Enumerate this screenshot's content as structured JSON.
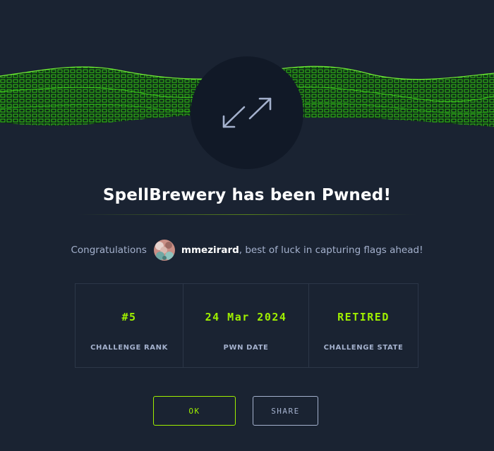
{
  "title": "SpellBrewery has been Pwned!",
  "congrats": {
    "prefix": "Congratulations",
    "username": "mmezirard",
    "suffix": ", best of luck in capturing flags ahead!"
  },
  "stats": [
    {
      "value": "#5",
      "label": "CHALLENGE RANK"
    },
    {
      "value": "24 Mar 2024",
      "label": "PWN DATE"
    },
    {
      "value": "RETIRED",
      "label": "CHALLENGE STATE"
    }
  ],
  "buttons": {
    "ok": "OK",
    "share": "SHARE"
  },
  "icons": {
    "badge": "expand-arrows-icon"
  },
  "colors": {
    "background": "#1a2332",
    "accent": "#9fef00",
    "muted_text": "#a4b1cd",
    "badge_bg": "#111927",
    "border": "#2c3748"
  }
}
